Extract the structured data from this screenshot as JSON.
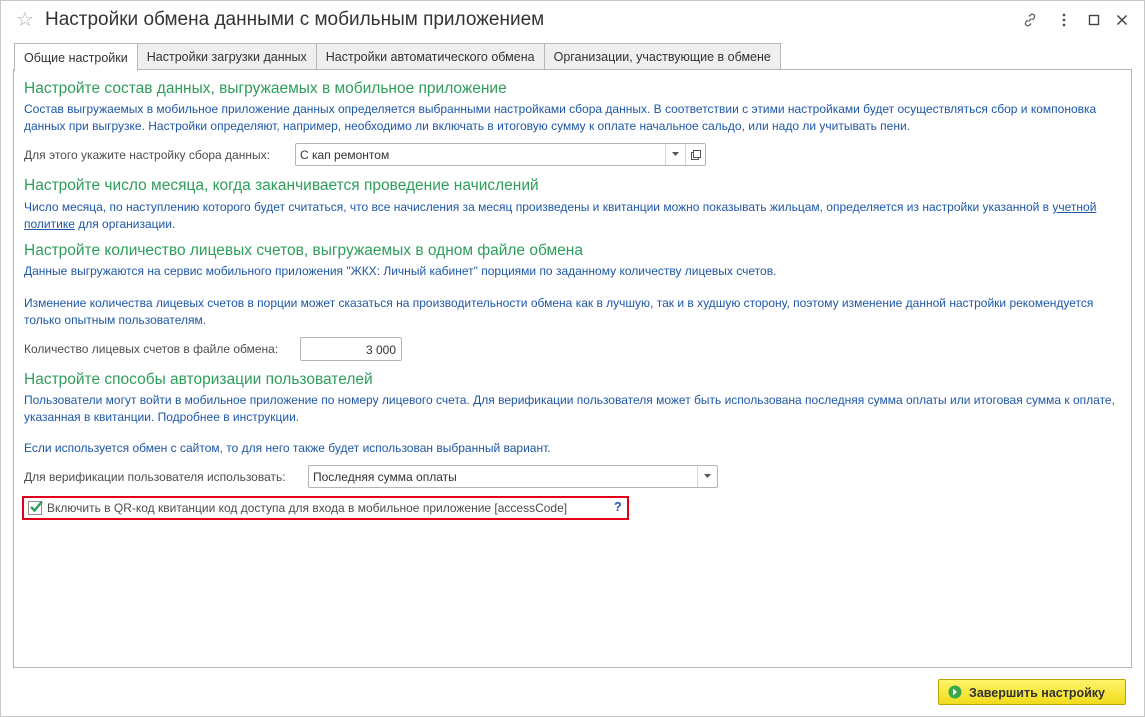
{
  "window": {
    "title": "Настройки обмена данными с мобильным приложением"
  },
  "tabs": [
    {
      "label": "Общие настройки",
      "active": true
    },
    {
      "label": "Настройки загрузки данных",
      "active": false
    },
    {
      "label": "Настройки автоматического обмена",
      "active": false
    },
    {
      "label": "Организации, участвующие в обмене",
      "active": false
    }
  ],
  "sections": {
    "data_composition": {
      "heading": "Настройте состав данных, выгружаемых в мобильное приложение",
      "text": "Состав выгружаемых в мобильное приложение данных определяется выбранными настройками сбора данных. В соответствии с этими настройками будет осуществляться сбор и компоновка данных при выгрузке. Настройки определяют, например, необходимо ли включать в итоговую сумму к оплате начальное сальдо, или надо ли учитывать пени.",
      "field_label": "Для этого укажите настройку сбора данных:",
      "field_value": "С кап ремонтом"
    },
    "accrual_day": {
      "heading": "Настройте число месяца, когда заканчивается проведение начислений",
      "text_before": "Число месяца, по наступлению которого будет считаться, что все начисления за месяц произведены и квитанции можно показывать жильцам, определяется из настройки указанной в ",
      "link": "учетной политике",
      "text_after": " для организации."
    },
    "accounts_per_file": {
      "heading": "Настройте количество лицевых счетов, выгружаемых в одном файле обмена",
      "text1": "Данные выгружаются на сервис мобильного приложения \"ЖКХ: Личный кабинет\" порциями по заданному количеству лицевых счетов.",
      "text2": "Изменение количества лицевых счетов в порции может сказаться на производительности обмена как в лучшую, так и в худшую сторону, поэтому изменение данной настройки рекомендуется только опытным пользователям.",
      "field_label": "Количество лицевых счетов в файле обмена:",
      "field_value": "3 000"
    },
    "authorization": {
      "heading": "Настройте способы авторизации пользователей",
      "text1": "Пользователи могут войти в мобильное приложение по номеру лицевого счета. Для верификации пользователя может быть использована последняя сумма оплаты или итоговая сумма к оплате, указанная в квитанции. Подробнее в инструкции.",
      "text2": "Если используется обмен с сайтом, то для него также будет использован выбранный вариант.",
      "field_label": "Для верификации пользователя использовать:",
      "field_value": "Последняя сумма оплаты"
    }
  },
  "qr_checkbox": {
    "label": "Включить в QR-код квитанции код доступа для входа в мобильное приложение [accessCode]",
    "checked": true,
    "help": "?"
  },
  "footer": {
    "finish_label": "Завершить настройку"
  },
  "colors": {
    "heading": "#2e9e5a",
    "text": "#1e57a8",
    "highlight": "#e0001b",
    "button": "#f1dc1d"
  }
}
